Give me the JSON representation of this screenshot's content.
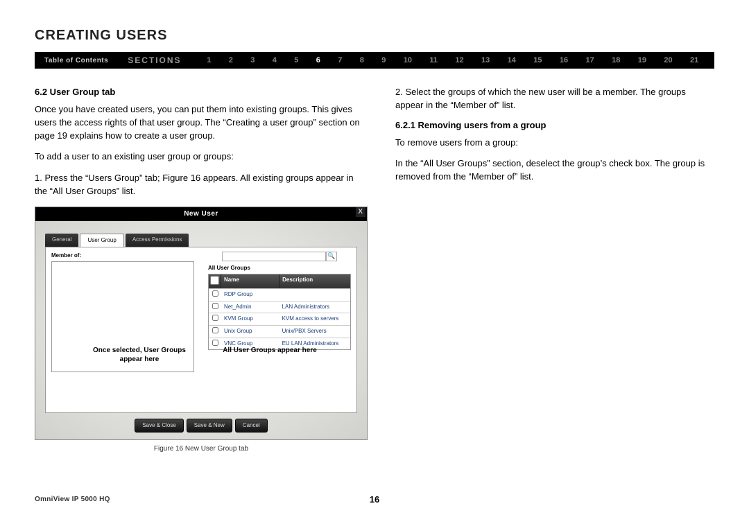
{
  "page_title": "CREATING USERS",
  "nav": {
    "toc_label": "Table of Contents",
    "sections_label": "SECTIONS",
    "numbers": [
      "1",
      "2",
      "3",
      "4",
      "5",
      "6",
      "7",
      "8",
      "9",
      "10",
      "11",
      "12",
      "13",
      "14",
      "15",
      "16",
      "17",
      "18",
      "19",
      "20",
      "21"
    ],
    "active": "6"
  },
  "left_col": {
    "heading": "6.2 User Group tab",
    "para1": "Once you have created users, you can put them into existing groups. This gives users the access rights of that user group. The “Creating a user group” section on page 19 explains how to create a user group.",
    "para2": "To add a user to an existing user group or groups:",
    "step1": "1. Press the “Users Group” tab; Figure 16 appears. All existing groups appear in the “All User Groups” list."
  },
  "right_col": {
    "step2": "2. Select the groups of which the new user will be a member. The groups appear in the “Member of” list.",
    "heading": "6.2.1 Removing users from a group",
    "para1": "To remove users from a group:",
    "para2": "In the “All User Groups” section, deselect the group’s check box. The group is removed from the “Member of” list."
  },
  "figure": {
    "title": "New User",
    "close": "X",
    "tabs": {
      "general": "General",
      "user_group": "User Group",
      "access": "Access Permissions"
    },
    "member_of_label": "Member of:",
    "all_groups_label": "All User Groups",
    "grid_headers": {
      "name": "Name",
      "desc": "Description"
    },
    "rows": [
      {
        "name": "RDP Group",
        "desc": ""
      },
      {
        "name": "Net_Admin",
        "desc": "LAN Administrators"
      },
      {
        "name": "KVM Group",
        "desc": "KVM access to servers"
      },
      {
        "name": "Unix Group",
        "desc": "Unix/PBX Servers"
      },
      {
        "name": "VNC Group",
        "desc": "EU LAN Administrators"
      }
    ],
    "callout_left": "Once selected, User Groups appear here",
    "callout_right": "All User Groups appear here",
    "buttons": {
      "save_close": "Save & Close",
      "save_new": "Save & New",
      "cancel": "Cancel"
    },
    "caption": "Figure 16 New User Group tab"
  },
  "footer": {
    "product": "OmniView IP 5000 HQ",
    "page": "16"
  }
}
